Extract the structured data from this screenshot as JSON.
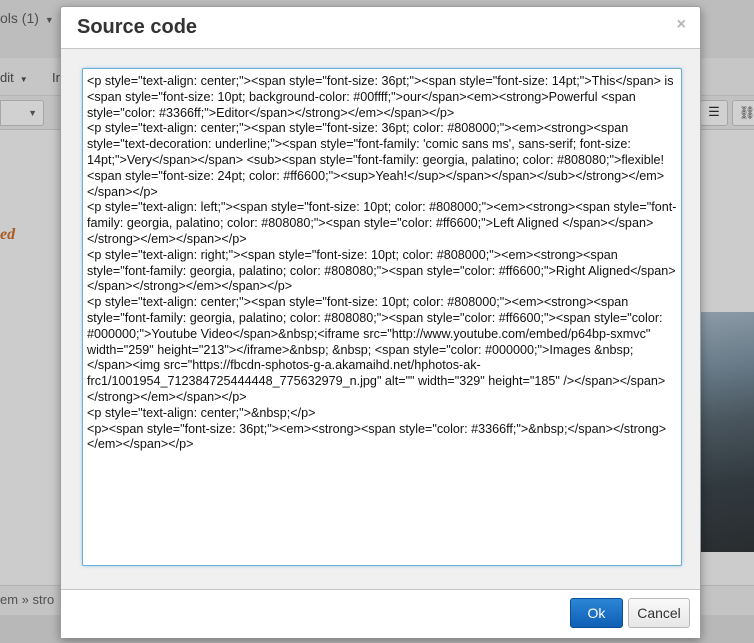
{
  "background": {
    "tools_tab": "ols (1)",
    "menu_edit": "dit",
    "menu_insert": "In",
    "content_fragment": "ed",
    "status_path": "em » stro"
  },
  "dialog": {
    "title": "Source code",
    "close_symbol": "×",
    "source_code": "<p style=\"text-align: center;\"><span style=\"font-size: 36pt;\"><span style=\"font-size: 14pt;\">This</span> is <span style=\"font-size: 10pt; background-color: #00ffff;\">our</span><em><strong>Powerful <span style=\"color: #3366ff;\">Editor</span></strong></em></span></p>\n<p style=\"text-align: center;\"><span style=\"font-size: 36pt; color: #808000;\"><em><strong><span style=\"text-decoration: underline;\"><span style=\"font-family: 'comic sans ms', sans-serif; font-size: 14pt;\">Very</span></span> <sub><span style=\"font-family: georgia, palatino; color: #808080;\">flexible! <span style=\"font-size: 24pt; color: #ff6600;\"><sup>Yeah!</sup></span></span></sub></strong></em></span></p>\n<p style=\"text-align: left;\"><span style=\"font-size: 10pt; color: #808000;\"><em><strong><span style=\"font-family: georgia, palatino; color: #808080;\"><span style=\"color: #ff6600;\">Left Aligned </span></span></strong></em></span></p>\n<p style=\"text-align: right;\"><span style=\"font-size: 10pt; color: #808000;\"><em><strong><span style=\"font-family: georgia, palatino; color: #808080;\"><span style=\"color: #ff6600;\">Right Aligned</span></span></strong></em></span></p>\n<p style=\"text-align: center;\"><span style=\"font-size: 10pt; color: #808000;\"><em><strong><span style=\"font-family: georgia, palatino; color: #808080;\"><span style=\"color: #ff6600;\"><span style=\"color: #000000;\">Youtube Video</span>&nbsp;<iframe src=\"http://www.youtube.com/embed/p64bp-sxmvc\" width=\"259\" height=\"213\"></iframe>&nbsp; &nbsp; <span style=\"color: #000000;\">Images &nbsp;</span><img src=\"https://fbcdn-sphotos-g-a.akamaihd.net/hphotos-ak-frc1/1001954_712384725444448_775632979_n.jpg\" alt=\"\" width=\"329\" height=\"185\" /></span></span></strong></em></span></p>\n<p style=\"text-align: center;\">&nbsp;</p>\n<p><span style=\"font-size: 36pt;\"><em><strong><span style=\"color: #3366ff;\">&nbsp;</span></strong></em></span></p>",
    "ok_label": "Ok",
    "cancel_label": "Cancel"
  },
  "colors": {
    "ok_button": "#1b6fc4",
    "focus_border": "#6eafd4",
    "content_accent": "#c0621d"
  }
}
